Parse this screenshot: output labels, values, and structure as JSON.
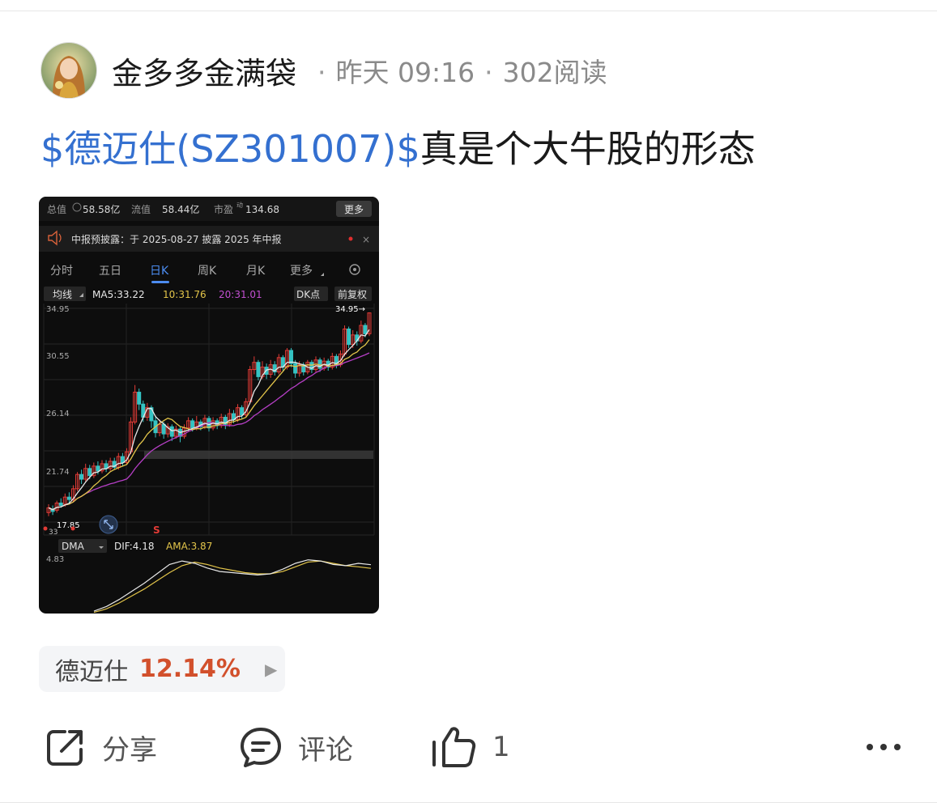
{
  "author": {
    "name": "金多多金满袋",
    "time": "昨天 09:16",
    "reads": "302阅读",
    "separator": "·"
  },
  "post": {
    "cashtag": "$德迈仕(SZ301007)$",
    "text": "真是个大牛股的形态"
  },
  "screenshot": {
    "stats": {
      "total_label": "总值",
      "total_value": "58.58亿",
      "float_label": "流值",
      "float_value": "58.44亿",
      "pe_label": "市盈",
      "pe_sup": "动",
      "pe_value": "134.68",
      "more_button": "更多"
    },
    "notice": "中报预披露：于 2025-08-27 披露 2025 年中报",
    "tabs": [
      "分时",
      "五日",
      "日K",
      "周K",
      "月K",
      "更多"
    ],
    "active_tab": "日K",
    "ma_bar": {
      "selector": "均线",
      "ma5": "MA5:33.22",
      "ma10": "10:31.76",
      "ma20": "20:31.01",
      "dk_button": "DK点",
      "adjust_button": "前复权"
    },
    "axis_labels": [
      "34.95",
      "30.55",
      "26.14",
      "21.74"
    ],
    "high_marker": "34.95→",
    "low_marker": "17.85",
    "low_marker_2": "33",
    "s_marker": "S",
    "indicator_bar": {
      "selector": "DMA",
      "dif": "DIF:4.18",
      "ama": "AMA:3.87",
      "axis_value": "4.83"
    },
    "colors": {
      "up": "#e23b36",
      "down": "#34c3c3",
      "ma5": "#e8e8e8",
      "ma10": "#e3c54a",
      "ma20": "#b63fc6",
      "tab_active": "#4c8cf0"
    }
  },
  "stock_chip": {
    "name": "德迈仕",
    "change": "12.14%",
    "arrow": "▶"
  },
  "actions": {
    "share_label": "分享",
    "comment_label": "评论",
    "like_count": "1",
    "more_icon": "more-dots-icon"
  }
}
